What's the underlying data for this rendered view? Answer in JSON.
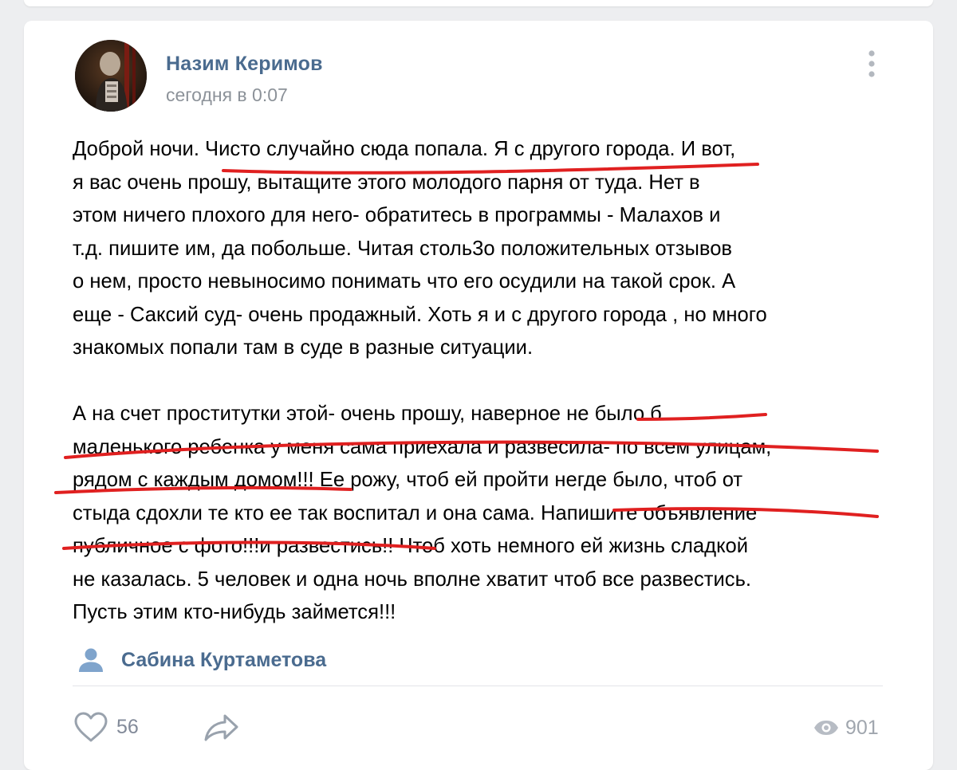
{
  "post": {
    "author": "Назим Керимов",
    "time": "сегодня в 0:07",
    "paragraphs": [
      [
        "Доброй ночи. Чисто случайно сюда попала. Я с другого города. И вот,",
        "я вас очень прошу, вытащите  этого молодого парня от туда. Нет в",
        "этом ничего плохого для него- обратитесь в программы - Малахов и",
        "т.д. пишите им, да побольше. Читая столь3о положительных отзывов",
        "о нем, просто невыносимо понимать что его осудили на такой срок. А",
        "еще - Саксий суд- очень продажный. Хоть я и с другого города , но много",
        "знакомых попали там в суде в разные ситуации."
      ],
      [
        "А на счет проститутки  этой- очень прошу, наверное не было б",
        "маленького ребенка у меня сама приехала и развесила- по всем улицам,",
        "рядом с каждым домом!!! Ее рожу, чтоб ей пройти негде было, чтоб от",
        "стыда сдохли те кто ее  так воспитал и она сама. Напишите объявление",
        "публичное с фото!!!и развестись!! Чтоб хоть немного ей жизнь сладкой",
        "не казалась. 5 человек и одна ночь вполне хватит чтоб все развестись.",
        "Пусть этим кто-нибудь займется!!!"
      ]
    ],
    "signer": "Сабина Куртаметова",
    "likes": "56",
    "views": "901"
  },
  "colors": {
    "background": "#edeef0",
    "card": "#ffffff",
    "link": "#4a6b8f",
    "secondary": "#8c9299",
    "icon": "#99a2ad",
    "annotation": "#e02020"
  },
  "icons": {
    "menu": "more-vertical-icon",
    "signer": "user-icon",
    "like": "heart-icon",
    "share": "share-icon",
    "views": "eye-icon"
  }
}
